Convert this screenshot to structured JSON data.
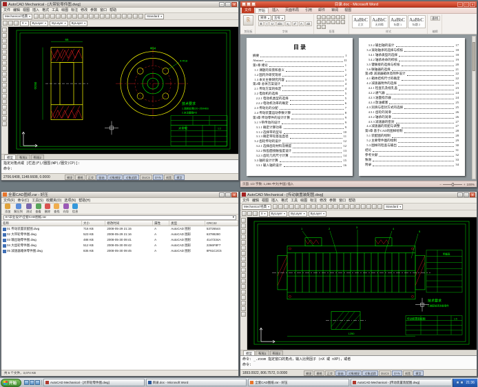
{
  "taskbar": {
    "start_label": "开始",
    "quick": [
      "ie",
      "show-desktop",
      "media-player"
    ],
    "buttons": [
      {
        "label": "AutoCAD Mechanical - [大带轮零件图.dwg]",
        "color": "#b03a2e"
      },
      {
        "label": "目录.doc - Microsoft Word",
        "color": "#2b579a"
      },
      {
        "label": "全套CAD图纸.rar - 好压",
        "color": "#e8762c"
      },
      {
        "label": "AutoCAD Mechanical - [传动装置装配图.dwg]",
        "color": "#b03a2e"
      }
    ],
    "tray_icons": [
      "volume",
      "network"
    ],
    "time": "21:36"
  },
  "cad1": {
    "title": "AutoCAD Mechanical - [大带轮零件图.dwg]",
    "workspace": "Mechanical 经典",
    "menu": [
      "文件",
      "编辑",
      "视图",
      "插入",
      "格式",
      "工具",
      "绘图",
      "标注",
      "修改",
      "参数",
      "窗口",
      "帮助"
    ],
    "std_icons": [
      "new",
      "open",
      "save",
      "plot",
      "plot-preview",
      "publish",
      "cut",
      "copy",
      "paste",
      "match-properties",
      "undo",
      "redo",
      "pan",
      "zoom-realtime",
      "zoom-window",
      "zoom-previous",
      "properties",
      "designcenter",
      "tool-palettes",
      "help"
    ],
    "layer_icons": [
      "layer-properties",
      "layer-states",
      "make-object-layer-current"
    ],
    "draw_icons": [
      "line",
      "construction-line",
      "polyline",
      "polygon",
      "rectangle",
      "arc",
      "circle",
      "revision-cloud",
      "spline",
      "ellipse",
      "insert-block",
      "make-block",
      "point",
      "hatch",
      "gradient",
      "region",
      "table",
      "multiline-text"
    ],
    "style_value": "Standard",
    "layer_value": "0",
    "color_value": "ByLayer",
    "linetype_value": "ByLayer",
    "lineweight_value": "ByLayer",
    "doc_tabs": [
      "模型",
      "布局1",
      "布局2"
    ],
    "active_tab": "模型",
    "command_line1": "指定对角点或 [栏选(F)/圈围(WP)/圈交(CP)]:",
    "command_line2": "命令:",
    "coords": "2706.6408, 1148.6608, 0.0000",
    "modes": [
      {
        "l": "捕捉",
        "on": false
      },
      {
        "l": "栅格",
        "on": false
      },
      {
        "l": "正交",
        "on": false
      },
      {
        "l": "极轴",
        "on": true
      },
      {
        "l": "对象捕捉",
        "on": true
      },
      {
        "l": "对象追踪",
        "on": true
      },
      {
        "l": "DUCS",
        "on": false
      },
      {
        "l": "DYN",
        "on": true
      },
      {
        "l": "线宽",
        "on": false
      },
      {
        "l": "模型",
        "on": true
      }
    ],
    "drawing": {
      "dim_left": "Φ250",
      "dim_top": "66",
      "dim_right": "Φ94",
      "dim_holes": "4-Φ18",
      "tech": "技术要求",
      "note1": "1.调质处理220~250HBS",
      "note2": "2.未注圆角R3",
      "part_name": "大带轮",
      "scale": "1:2"
    }
  },
  "cad2": {
    "title": "AutoCAD Mechanical - [传动装置装配图.dwg]",
    "workspace": "Mechanical 经典",
    "menu": [
      "文件",
      "编辑",
      "视图",
      "插入",
      "格式",
      "工具",
      "绘图",
      "标注",
      "修改",
      "参数",
      "窗口",
      "帮助"
    ],
    "std_icons": [
      "new",
      "open",
      "save",
      "plot",
      "plot-preview",
      "publish",
      "cut",
      "copy",
      "paste",
      "match-properties",
      "undo",
      "redo",
      "pan",
      "zoom-realtime",
      "zoom-window",
      "zoom-previous",
      "properties",
      "designcenter",
      "tool-palettes",
      "help"
    ],
    "layer_icons": [
      "layer-properties",
      "layer-states",
      "make-object-layer-current"
    ],
    "draw_icons": [
      "line",
      "construction-line",
      "polyline",
      "polygon",
      "rectangle",
      "arc",
      "circle",
      "revision-cloud",
      "spline",
      "ellipse",
      "insert-block",
      "make-block",
      "point",
      "hatch",
      "gradient",
      "region",
      "table",
      "multiline-text"
    ],
    "style_value": "Standard",
    "layer_value": "0",
    "color_value": "ByLayer",
    "linetype_value": "ByLayer",
    "lineweight_value": "ByLayer",
    "doc_tabs": [
      "模型",
      "布局1",
      "布局2"
    ],
    "active_tab": "模型",
    "command_line1": "命令: _.zoom 指定窗口的角点，输入比例因子 (nX 或 nXP)，或者",
    "command_line2": "命令:",
    "coords": "1893.0922, 806.7572, 0.0000",
    "modes": [
      {
        "l": "捕捉",
        "on": false
      },
      {
        "l": "栅格",
        "on": false
      },
      {
        "l": "正交",
        "on": false
      },
      {
        "l": "极轴",
        "on": true
      },
      {
        "l": "对象捕捉",
        "on": true
      },
      {
        "l": "对象追踪",
        "on": true
      },
      {
        "l": "DUCS",
        "on": false
      },
      {
        "l": "DYN",
        "on": true
      },
      {
        "l": "线宽",
        "on": false
      },
      {
        "l": "模型",
        "on": true
      }
    ],
    "drawing": {
      "balloons": [
        "1",
        "2",
        "3",
        "4",
        "5"
      ],
      "dim_bottom": "1250",
      "bom_title": "明细表",
      "tech": "技术要求",
      "note1": "1.装配前清洗各零件",
      "part_name": "传动装置装配图",
      "scale": "1:5"
    }
  },
  "word": {
    "title": "目录.doc - Microsoft Word",
    "qat": [
      "save",
      "undo",
      "repeat"
    ],
    "tabs": [
      "文件",
      "开始",
      "插入",
      "页面布局",
      "引用",
      "邮件",
      "审阅",
      "视图"
    ],
    "active_tab": "开始",
    "paste_label": "粘贴",
    "font_name": "宋体",
    "font_size": "五号",
    "font_buttons": [
      {
        "g": "B",
        "n": "bold"
      },
      {
        "g": "I",
        "n": "italic"
      },
      {
        "g": "U",
        "n": "underline"
      },
      {
        "g": "abc",
        "n": "strikethrough"
      },
      {
        "g": "x₂",
        "n": "subscript"
      },
      {
        "g": "x²",
        "n": "superscript"
      },
      {
        "g": "A",
        "n": "font-color"
      },
      {
        "g": "ab",
        "n": "text-highlight"
      }
    ],
    "para_icons": [
      "bullets",
      "numbering",
      "multilevel-list",
      "decrease-indent",
      "increase-indent",
      "sort",
      "show-formatting",
      "align-left",
      "align-center",
      "align-right",
      "justify",
      "line-spacing",
      "shading",
      "borders"
    ],
    "styles": [
      {
        "preview": "AaBbC",
        "label": "正文"
      },
      {
        "preview": "AaBbC",
        "label": "无间隔"
      },
      {
        "preview": "AaBbC",
        "label": "标题 1"
      },
      {
        "preview": "AaBbC",
        "label": "标题 2"
      }
    ],
    "group_labels": {
      "clipboard": "剪贴板",
      "font": "字体",
      "paragraph": "段落",
      "styles": "样式",
      "editing": "编辑"
    },
    "editing_label": "查找",
    "heading": "目  录",
    "toc_left": [
      {
        "t": "摘要",
        "p": "I"
      },
      {
        "t": "Abstract",
        "p": "II"
      },
      {
        "t": "第1章 绪论",
        "p": "1"
      },
      {
        "t": "  1.1 课题的背景和意义",
        "p": "1"
      },
      {
        "t": "  1.2 国内外研究现状",
        "p": "2"
      },
      {
        "t": "  1.3 本文主要研究内容",
        "p": "3"
      },
      {
        "t": "第2章 总体方案设计",
        "p": "4"
      },
      {
        "t": "  2.1 传动方案的拟定",
        "p": "4"
      },
      {
        "t": "  2.2 电动机的选择",
        "p": "5"
      },
      {
        "t": "    2.2.1 电动机类型的选择",
        "p": "5"
      },
      {
        "t": "    2.2.2 电动机功率的确定",
        "p": "6"
      },
      {
        "t": "  2.3 传动比的分配",
        "p": "7"
      },
      {
        "t": "  2.4 传动装置运动参数计算",
        "p": "8"
      },
      {
        "t": "第3章 传动零件的设计计算",
        "p": "9"
      },
      {
        "t": "  3.1 V带传动的设计",
        "p": "9"
      },
      {
        "t": "    3.1.1 确定计算功率",
        "p": "9"
      },
      {
        "t": "    3.1.2 选择带的型号",
        "p": "10"
      },
      {
        "t": "    3.1.3 确定带轮基准直径",
        "p": "11"
      },
      {
        "t": "  3.2 齿轮传动的设计",
        "p": "12"
      },
      {
        "t": "    3.2.1 选择齿轮材料及精度",
        "p": "12"
      },
      {
        "t": "    3.2.2 按齿面接触强度设计",
        "p": "13"
      },
      {
        "t": "    3.2.3 齿轮几何尺寸计算",
        "p": "14"
      },
      {
        "t": "  3.3 轴的设计计算",
        "p": "15"
      },
      {
        "t": "    3.3.1 输入轴的设计",
        "p": "16"
      }
    ],
    "toc_right": [
      {
        "t": "    3.3.2 输出轴的设计",
        "p": "17"
      },
      {
        "t": "  3.4 滚动轴承的选择与校核",
        "p": "18"
      },
      {
        "t": "    3.4.1 轴承类型的选择",
        "p": "18"
      },
      {
        "t": "    3.4.2 轴承寿命的校核",
        "p": "19"
      },
      {
        "t": "  3.5 键联接的选择与校核",
        "p": "20"
      },
      {
        "t": "  3.6 联轴器的选择",
        "p": "21"
      },
      {
        "t": "第4章 减速器箱体及附件设计",
        "p": "22"
      },
      {
        "t": "  4.1 箱体结构尺寸的确定",
        "p": "22"
      },
      {
        "t": "  4.2 减速器附件的选择",
        "p": "23"
      },
      {
        "t": "    4.2.1 检查孔及视孔盖",
        "p": "23"
      },
      {
        "t": "    4.2.2 通气器",
        "p": "24"
      },
      {
        "t": "    4.2.3 油面指示器",
        "p": "24"
      },
      {
        "t": "    4.2.4 放油螺塞",
        "p": "25"
      },
      {
        "t": "  4.3 润滑与密封方式的选择",
        "p": "25"
      },
      {
        "t": "    4.3.1 齿轮的润滑",
        "p": "26"
      },
      {
        "t": "    4.3.2 轴承的润滑",
        "p": "26"
      },
      {
        "t": "    4.3.3 减速器的密封",
        "p": "27"
      },
      {
        "t": "  4.4 减速器的装配与调整",
        "p": "27"
      },
      {
        "t": "第5章 基于CAD的图样绘制",
        "p": "28"
      },
      {
        "t": "  5.1 装配图的绘制",
        "p": "28"
      },
      {
        "t": "  5.2 主要零件图的绘制",
        "p": "29"
      },
      {
        "t": "  5.3 图样的检查与输出",
        "p": "30"
      },
      {
        "t": "结论",
        "p": "31"
      },
      {
        "t": "参考文献",
        "p": "32"
      },
      {
        "t": "致谢",
        "p": "33"
      },
      {
        "t": "附录",
        "p": "34"
      }
    ],
    "status_left": "页面: 1/2    字数: 1,286    中文(中国)    插入",
    "zoom": "100%"
  },
  "files": {
    "title": "全套CAD图纸.rar - 好压",
    "menu": [
      "文件(F)",
      "命令(C)",
      "工具(S)",
      "收藏夹(O)",
      "选项(N)",
      "帮助(H)"
    ],
    "toolbar": [
      {
        "name": "add",
        "label": "添加",
        "color": "#e0a33b"
      },
      {
        "name": "extract",
        "label": "解压到",
        "color": "#5b8dd9"
      },
      {
        "name": "test",
        "label": "测试",
        "color": "#7a67ae"
      },
      {
        "name": "view",
        "label": "查看",
        "color": "#58a55c"
      },
      {
        "name": "delete",
        "label": "删除",
        "color": "#d9534f"
      },
      {
        "name": "find",
        "label": "查找",
        "color": "#f0ad4e"
      },
      {
        "name": "wizard",
        "label": "向导",
        "color": "#9b59b6"
      },
      {
        "name": "info",
        "label": "信息",
        "color": "#3498db"
      }
    ],
    "address": "E:\\毕业设计\\全套CAD图纸.rar",
    "columns": [
      {
        "label": "名称",
        "w": "34%"
      },
      {
        "label": "大小",
        "w": "10%"
      },
      {
        "label": "修改时间",
        "w": "20%"
      },
      {
        "label": "属性",
        "w": "7%"
      },
      {
        "label": "类型",
        "w": "15%"
      },
      {
        "label": "CRC32",
        "w": "14%"
      }
    ],
    "rows": [
      [
        "01 传动装置装配图.dwg",
        "716 KB",
        "2008-05-29 21:15",
        "A",
        "AutoCAD 图形",
        "53726544"
      ],
      [
        "02 大带轮零件图.dwg",
        "523 KB",
        "2008-05-29 21:16",
        "A",
        "AutoCAD 图形",
        "63788280"
      ],
      [
        "03 输出轴零件图.dwg",
        "488 KB",
        "2008-05-30 09:41",
        "A",
        "AutoCAD 图形",
        "4147234A"
      ],
      [
        "04 大齿轮零件图.dwg",
        "512 KB",
        "2008-05-30 09:42",
        "A",
        "AutoCAD 图形",
        "2266F8F7"
      ],
      [
        "05 减速器箱体零件图.dwg",
        "835 KB",
        "2008-05-30 09:45",
        "A",
        "AutoCAD 图形",
        "8F61C2C5"
      ]
    ],
    "status": "共 5 个文件，3,074 KB"
  }
}
